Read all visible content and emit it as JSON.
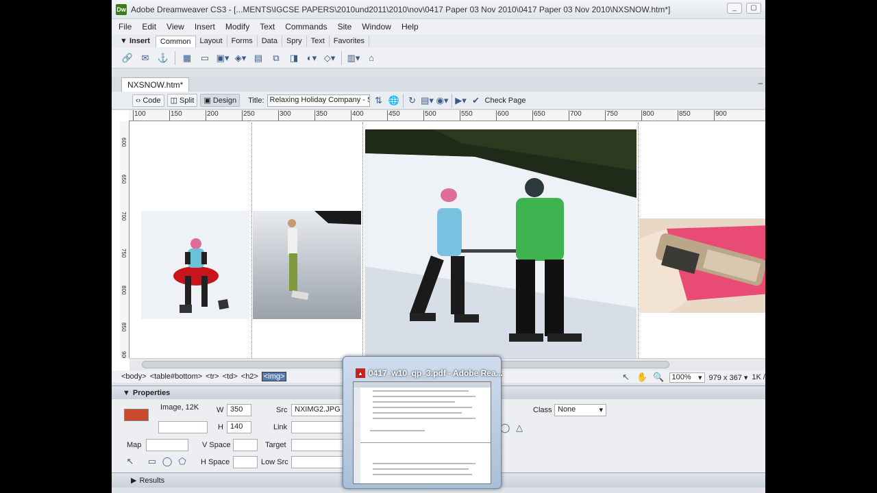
{
  "window": {
    "app_logo": "Dw",
    "title": "Adobe Dreamweaver CS3 - [...MENTS\\IGCSE PAPERS\\2010und2011\\2010\\nov\\0417 Paper 03 Nov 2010\\0417 Paper 03 Nov 2010\\NXSNOW.htm*]",
    "minimize": "_",
    "restore": "▢"
  },
  "menu": [
    "File",
    "Edit",
    "View",
    "Insert",
    "Modify",
    "Text",
    "Commands",
    "Site",
    "Window",
    "Help"
  ],
  "insert_bar": {
    "label": "▼ Insert",
    "tabs": [
      "Common",
      "Layout",
      "Forms",
      "Data",
      "Spry",
      "Text",
      "Favorites"
    ],
    "active_tab": "Common",
    "icons": [
      "hyperlink-icon",
      "email-link-icon",
      "named-anchor-icon",
      "table-icon",
      "div-icon",
      "image-icon",
      "media-icon",
      "date-icon",
      "server-side-include-icon",
      "comment-icon",
      "head-icon",
      "script-icon",
      "templates-icon",
      "tag-chooser-icon"
    ]
  },
  "document": {
    "tab": "NXSNOW.htm*",
    "close": "–",
    "views": [
      {
        "label": "Code",
        "icon": "code-view-icon"
      },
      {
        "label": "Split",
        "icon": "split-view-icon"
      },
      {
        "label": "Design",
        "icon": "design-view-icon"
      }
    ],
    "title_label": "Title:",
    "title_value": "Relaxing Holiday Company - Sn",
    "check_page": "Check Page"
  },
  "ruler": {
    "top_marks": [
      "100",
      "150",
      "200",
      "250",
      "300",
      "350",
      "400",
      "450",
      "500",
      "550",
      "600",
      "650",
      "700",
      "750",
      "800",
      "850",
      "900"
    ],
    "left_marks": [
      "600",
      "650",
      "700",
      "750",
      "800",
      "850",
      "900"
    ]
  },
  "canvas": {
    "photos": [
      {
        "name": "sled-child-photo"
      },
      {
        "name": "snowboarder-photo"
      },
      {
        "name": "ski-lesson-photo"
      },
      {
        "name": "mobile-phone-photo"
      }
    ]
  },
  "status": {
    "tags": [
      "<body>",
      "<table#bottom>",
      "<tr>",
      "<td>",
      "<h2>"
    ],
    "selected_tag": "<img>",
    "zoom": "100%",
    "dimensions": "979 x 367",
    "size": "1K /"
  },
  "properties": {
    "header": "Properties",
    "type": "Image, 12K",
    "name_value": "",
    "w_label": "W",
    "w_value": "350",
    "h_label": "H",
    "h_value": "140",
    "src_label": "Src",
    "src_value": "NXIMG2.JPG",
    "link_label": "Link",
    "link_value": "",
    "map_label": "Map",
    "map_value": "",
    "vspace_label": "V Space",
    "vspace_value": "",
    "hspace_label": "H Space",
    "hspace_value": "",
    "target_label": "Target",
    "target_value": "",
    "lowsrc_label": "Low Src",
    "lowsrc_value": "",
    "class_label": "Class",
    "class_value": "None"
  },
  "results": {
    "label": "Results"
  },
  "taskbar_thumbnail": {
    "title": "0417_w10_qp_3.pdf - Adobe Rea..."
  }
}
